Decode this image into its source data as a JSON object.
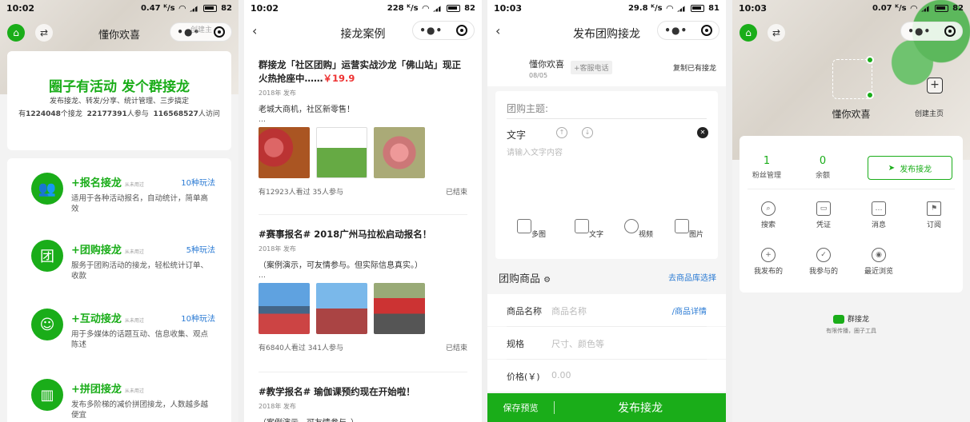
{
  "screen1": {
    "status": {
      "time": "10:02",
      "net": "0.47 ᴷ/s",
      "battery": "82"
    },
    "nav": {
      "title": "懂你欢喜",
      "create": "创建主"
    },
    "hero": {
      "slogan": "圈子有活动 发个群接龙",
      "subtitle": "发布接龙、转发/分享、统计管理、三步搞定",
      "stats": [
        {
          "prefix": "有",
          "value": "1224048",
          "suffix": "个接龙"
        },
        {
          "prefix": "",
          "value": "22177391",
          "suffix": "人参与"
        },
        {
          "prefix": "",
          "value": "116568527",
          "suffix": "人访问"
        }
      ]
    },
    "features": [
      {
        "icon": "people-signup-icon",
        "title": "+报名接龙",
        "tag": "从未用过",
        "count": "10种玩法",
        "desc": "适用于各种活动报名，自动统计，简单高效"
      },
      {
        "icon": "group-buy-icon",
        "title": "+团购接龙",
        "tag": "从未用过",
        "count": "5种玩法",
        "desc": "服务于团购活动的接龙，轻松统计订单、收款"
      },
      {
        "icon": "interact-icon",
        "title": "+互动接龙",
        "tag": "从未用过",
        "count": "10种玩法",
        "desc": "用于多媒体的话题互动、信息收集、观点陈述"
      },
      {
        "icon": "chart-group-icon",
        "title": "+拼团接龙",
        "tag": "从未用过",
        "count": "",
        "desc": "发布多阶梯的减价拼团接龙，人数越多越便宜"
      }
    ]
  },
  "screen2": {
    "status": {
      "time": "10:02",
      "net": "228 ᴷ/s",
      "battery": "82"
    },
    "nav": {
      "title": "接龙案例"
    },
    "articles": [
      {
        "title": "群接龙「社区团购」运营实战沙龙「佛山站」现正火热抢座中……",
        "price": "￥19.9",
        "year": "2018年 发布",
        "body": "老城大商机，社区新零售！",
        "ellipsis": "…",
        "views": "有12923人看过 35人参与",
        "status": "已结束"
      },
      {
        "title": "#赛事报名# 2018广州马拉松启动报名！",
        "price": "",
        "year": "2018年 发布",
        "body": "（案例演示，可友情参与。但实际信息真实。）",
        "ellipsis": "…",
        "views": "有6840人看过 341人参与",
        "status": "已结束"
      },
      {
        "title": "#教学报名# 瑜伽课预约现在开始啦！",
        "price": "",
        "year": "2018年 发布",
        "body": "（案例演示，可友情参与。）",
        "ellipsis": "",
        "views": "",
        "status": ""
      }
    ]
  },
  "screen3": {
    "status": {
      "time": "10:03",
      "net": "29.8 ᴷ/s",
      "battery": "81"
    },
    "nav": {
      "title": "发布团购接龙"
    },
    "user": {
      "name": "懂你欢喜",
      "date": "08/05",
      "phone_btn": "+客服电话",
      "copy": "复制已有接龙"
    },
    "topic_placeholder": "团购主题:",
    "text_label": "文字",
    "text_placeholder": "请输入文字内容",
    "media": [
      {
        "icon": "multi-image-icon",
        "label": "多图"
      },
      {
        "icon": "text-edit-icon",
        "label": "文字"
      },
      {
        "icon": "video-play-icon",
        "label": "视频"
      },
      {
        "icon": "image-add-icon",
        "label": "图片"
      }
    ],
    "goods": {
      "title": "团购商品",
      "link": "去商品库选择"
    },
    "fields": [
      {
        "label": "商品名称",
        "placeholder": "商品名称",
        "extra": "/商品详情"
      },
      {
        "label": "规格",
        "placeholder": "尺寸、颜色等",
        "extra": ""
      },
      {
        "label": "价格(￥)",
        "placeholder": "0.00",
        "extra": ""
      }
    ],
    "bottom": {
      "save": "保存预览",
      "publish": "发布接龙"
    }
  },
  "screen4": {
    "status": {
      "time": "10:03",
      "net": "0.07 ᴷ/s",
      "battery": "82"
    },
    "profile": {
      "name": "懂你欢喜",
      "create": "创建主页"
    },
    "stats": [
      {
        "value": "1",
        "label": "粉丝管理"
      },
      {
        "value": "0",
        "label": "余额"
      }
    ],
    "publish_btn": "发布接龙",
    "menu": [
      {
        "icon": "search-icon",
        "label": "搜索"
      },
      {
        "icon": "ticket-icon",
        "label": "凭证"
      },
      {
        "icon": "message-icon",
        "label": "消息"
      },
      {
        "icon": "bookmark-icon",
        "label": "订阅"
      },
      {
        "icon": "plus-circle-icon",
        "label": "我发布的"
      },
      {
        "icon": "check-circle-icon",
        "label": "我参与的"
      },
      {
        "icon": "eye-icon",
        "label": "最近浏览"
      }
    ],
    "brand": {
      "name": "群接龙",
      "tagline": "有限传播，圈子工具"
    }
  }
}
